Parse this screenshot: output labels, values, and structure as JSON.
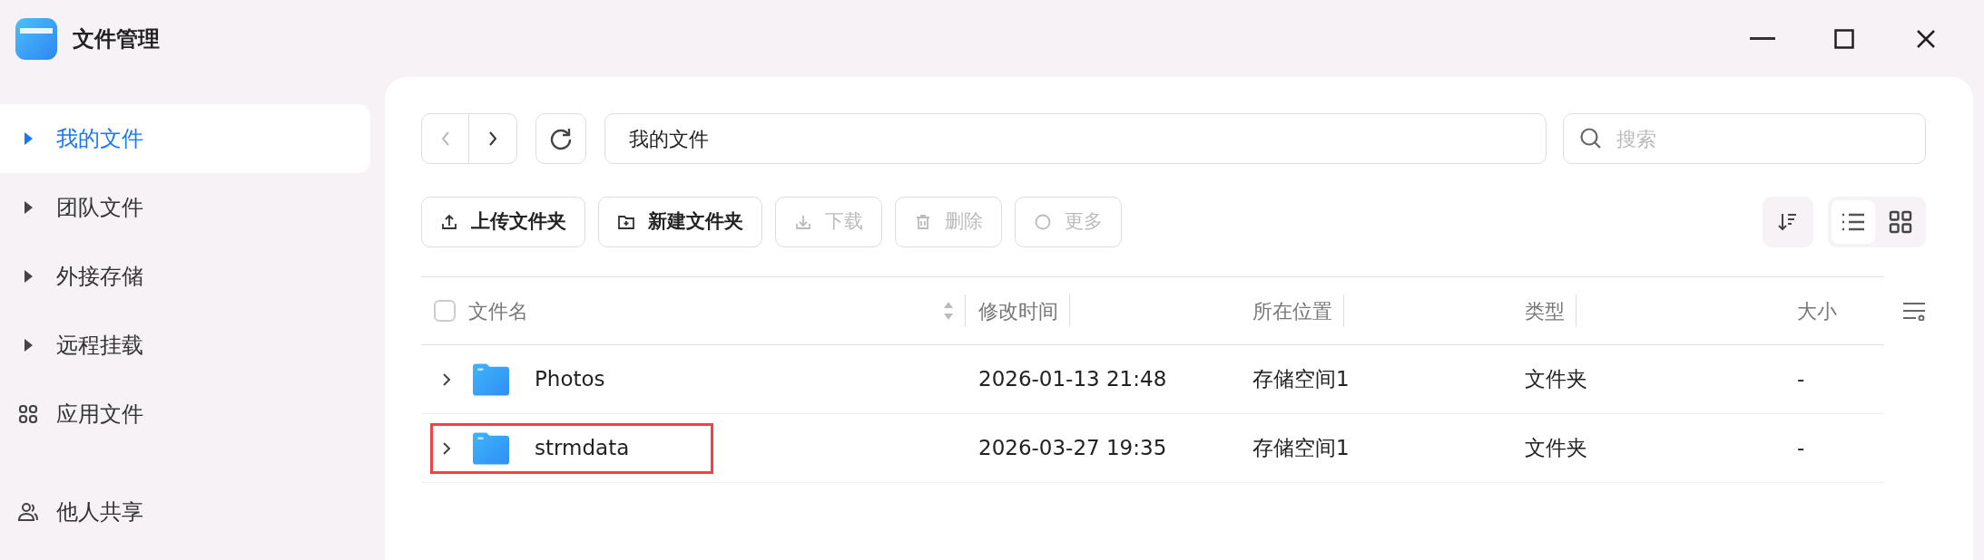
{
  "window": {
    "title": "文件管理"
  },
  "sidebar": {
    "sections": [
      {
        "items": [
          {
            "label": "我的文件",
            "kind": "tree",
            "selected": true
          },
          {
            "label": "团队文件",
            "kind": "tree",
            "selected": false
          },
          {
            "label": "外接存储",
            "kind": "tree",
            "selected": false
          },
          {
            "label": "远程挂载",
            "kind": "tree",
            "selected": false
          },
          {
            "label": "应用文件",
            "kind": "apps",
            "selected": false
          }
        ]
      },
      {
        "items": [
          {
            "label": "他人共享",
            "kind": "people",
            "selected": false
          }
        ]
      }
    ]
  },
  "path_field": {
    "value": "我的文件"
  },
  "search": {
    "placeholder": "搜索"
  },
  "actions": [
    {
      "label": "上传文件夹",
      "kind": "upload",
      "disabled": false
    },
    {
      "label": "新建文件夹",
      "kind": "new-folder",
      "disabled": false
    },
    {
      "label": "下载",
      "kind": "download",
      "disabled": true
    },
    {
      "label": "删除",
      "kind": "delete",
      "disabled": true
    },
    {
      "label": "更多",
      "kind": "more",
      "disabled": true
    }
  ],
  "view_toggle": [
    {
      "kind": "list",
      "selected": true
    },
    {
      "kind": "grid",
      "selected": false
    }
  ],
  "table": {
    "select_all_checked": false,
    "columns": [
      "文件名",
      "修改时间",
      "所在位置",
      "类型",
      "大小"
    ],
    "rows": [
      {
        "name": "Photos",
        "modified": "2026-01-13 21:48",
        "location": "存储空间1",
        "type": "文件夹",
        "size": "-",
        "highlighted": false
      },
      {
        "name": "strmdata",
        "modified": "2026-03-27 19:35",
        "location": "存储空间1",
        "type": "文件夹",
        "size": "-",
        "highlighted": true
      }
    ]
  }
}
